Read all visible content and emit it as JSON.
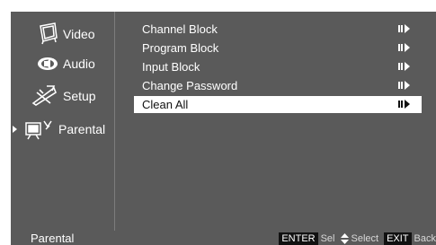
{
  "sidebar": {
    "items": [
      {
        "label": "Video",
        "icon": "tv-icon",
        "selected": false
      },
      {
        "label": "Audio",
        "icon": "speaker-icon",
        "selected": false
      },
      {
        "label": "Setup",
        "icon": "tools-icon",
        "selected": false
      },
      {
        "label": "Parental",
        "icon": "parental-icon",
        "selected": true
      }
    ]
  },
  "menu": {
    "items": [
      {
        "label": "Channel Block",
        "icon": "enter-arrow-icon",
        "selected": false
      },
      {
        "label": "Program Block",
        "icon": "enter-arrow-icon",
        "selected": false
      },
      {
        "label": "Input Block",
        "icon": "enter-arrow-icon",
        "selected": false
      },
      {
        "label": "Change Password",
        "icon": "enter-arrow-icon",
        "selected": false
      },
      {
        "label": "Clean All",
        "icon": "enter-arrow-icon",
        "selected": true
      }
    ]
  },
  "statusbar": {
    "title": "Parental",
    "hints": [
      {
        "key": "ENTER",
        "text": "Sel"
      },
      {
        "key": "⬍",
        "text": "Select"
      },
      {
        "key": "EXIT",
        "text": "Back"
      }
    ]
  },
  "colors": {
    "background": "#5a5a5a",
    "highlight": "#ffffff",
    "text": "#ffffff",
    "key_badge": "#111111"
  }
}
